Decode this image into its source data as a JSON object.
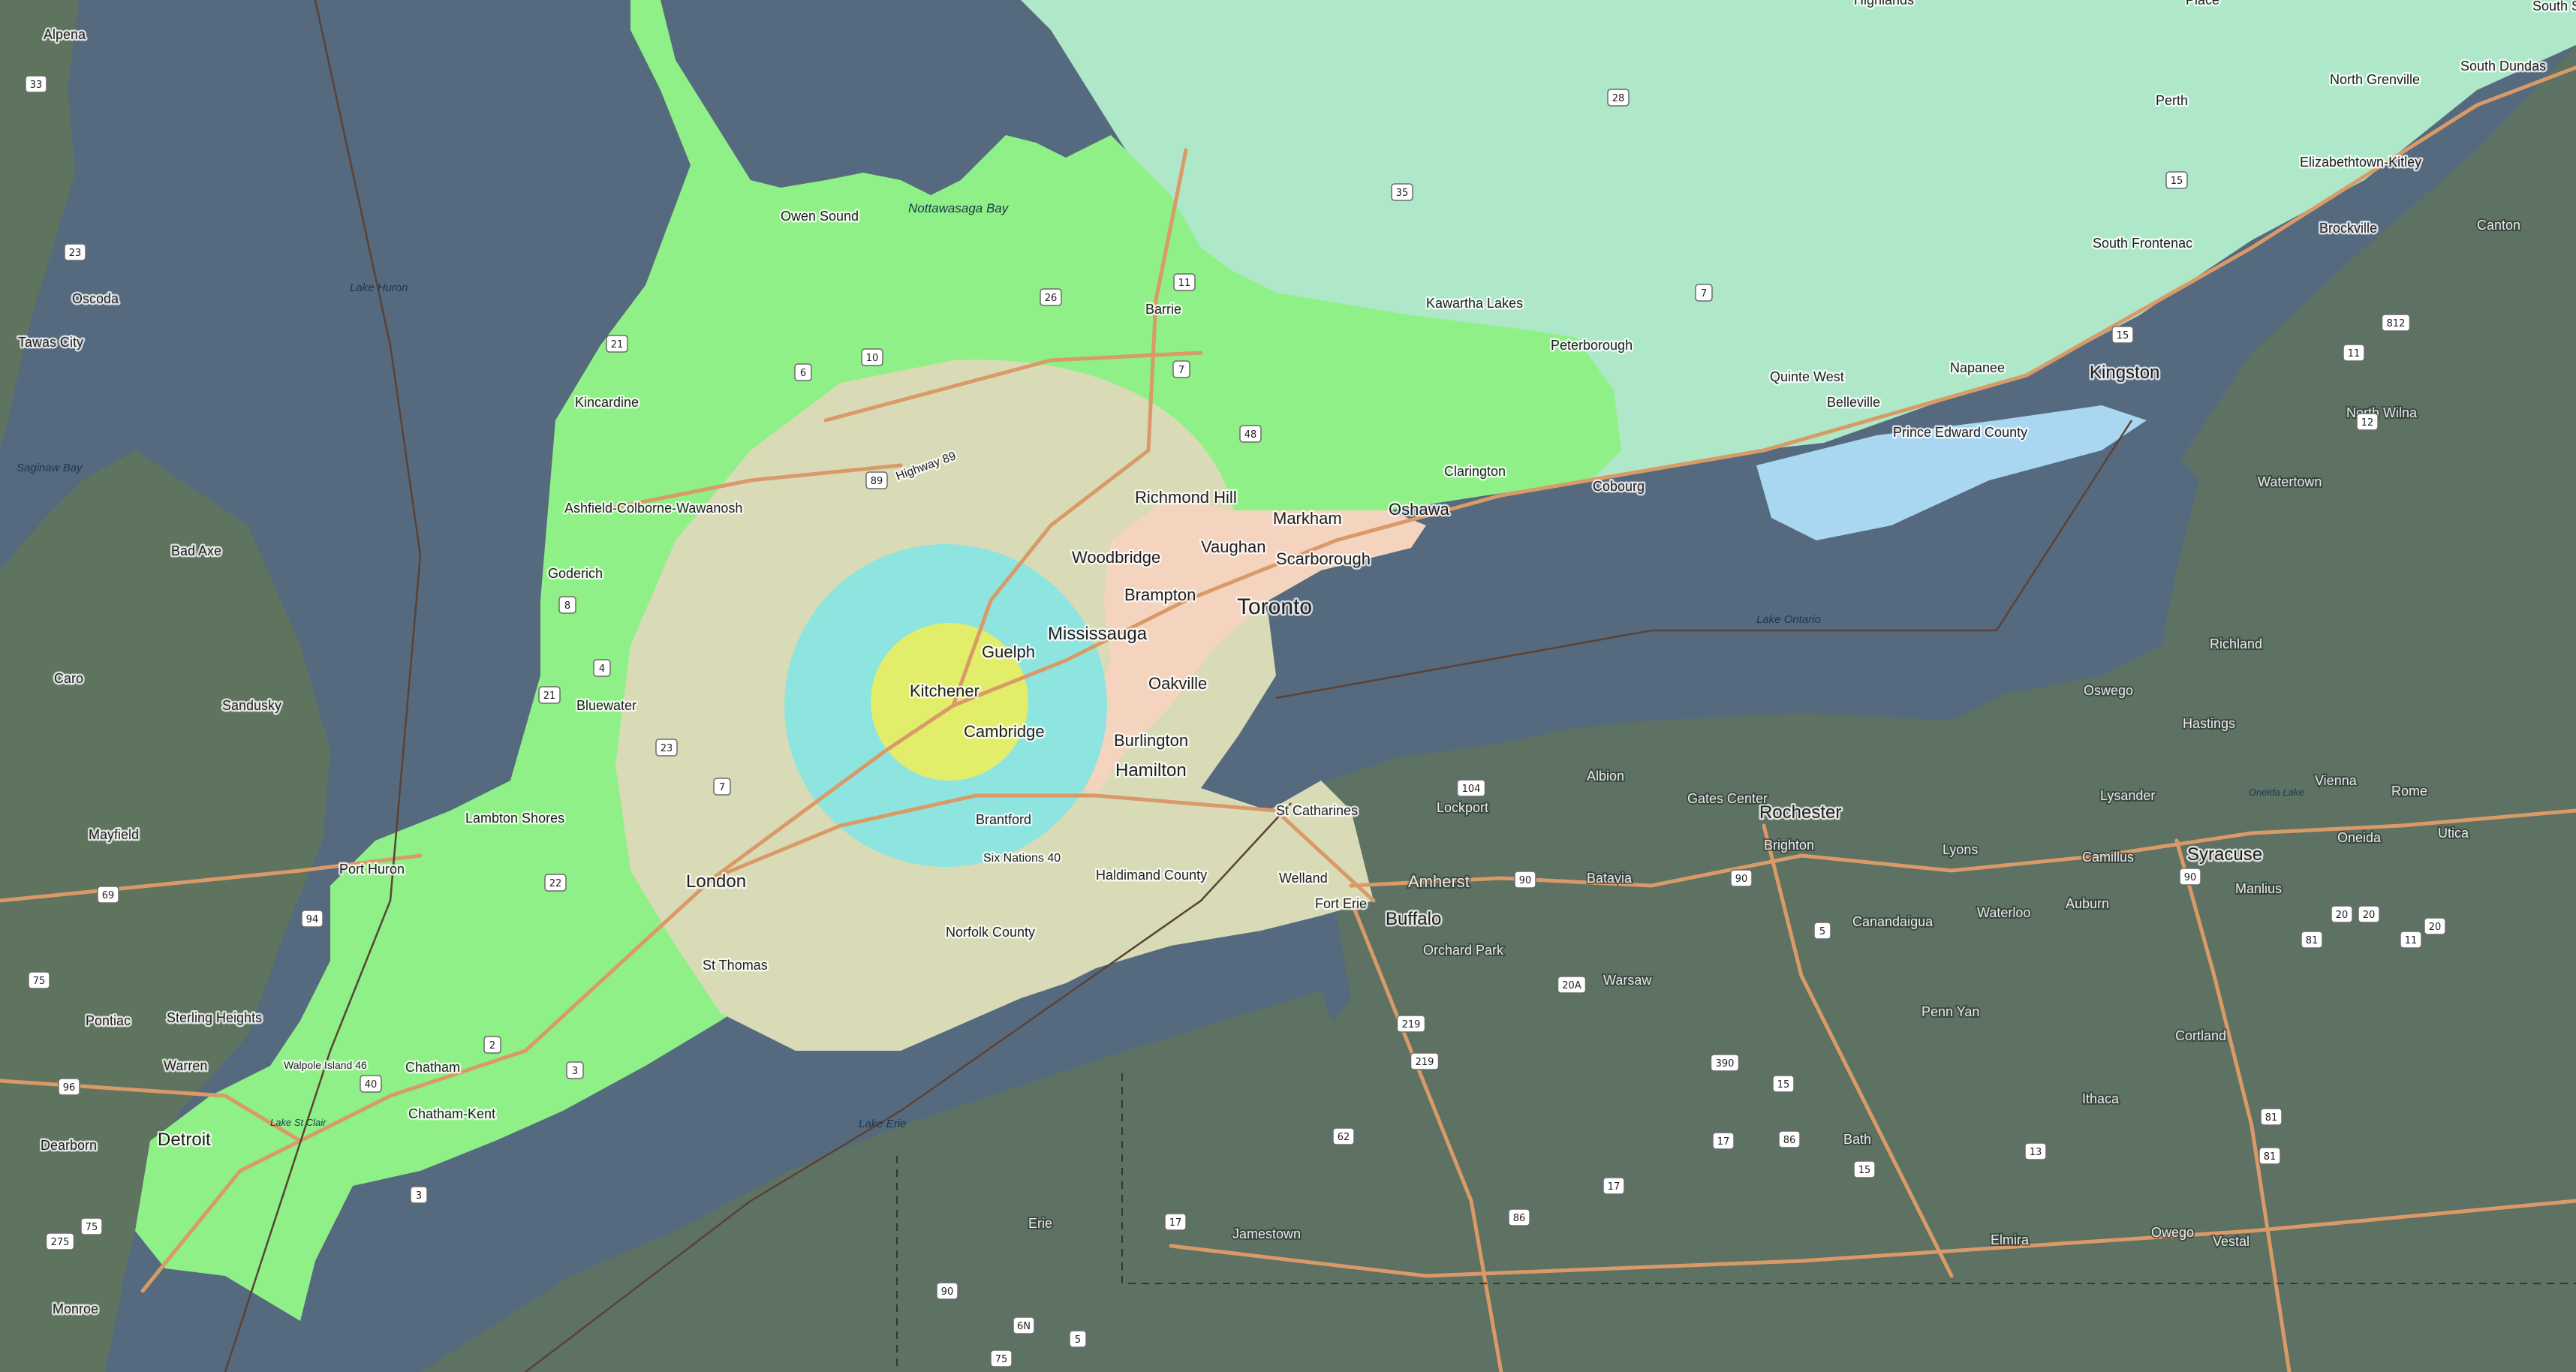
{
  "water_labels": [
    {
      "name": "nottawasaga-bay",
      "text": "Nottawasaga Bay"
    },
    {
      "name": "lake-huron",
      "text": "Lake Huron"
    },
    {
      "name": "saginaw-bay",
      "text": "Saginaw Bay"
    },
    {
      "name": "lake-ontario",
      "text": "Lake Ontario"
    },
    {
      "name": "lake-erie",
      "text": "Lake Erie"
    },
    {
      "name": "lake-st-clair",
      "text": "Lake St Clair"
    },
    {
      "name": "oneida-lake",
      "text": "Oneida Lake"
    }
  ],
  "major_cities": {
    "toronto": "Toronto",
    "kitchener": "Kitchener",
    "cambridge": "Cambridge",
    "guelph": "Guelph",
    "mississauga": "Mississauga",
    "hamilton": "Hamilton",
    "london": "London",
    "buffalo": "Buffalo",
    "rochester": "Rochester",
    "syracuse": "Syracuse",
    "detroit": "Detroit",
    "kingston": "Kingston"
  },
  "towns": {
    "alpena": "Alpena",
    "owen_sound": "Owen Sound",
    "barrie": "Barrie",
    "kincardine": "Kincardine",
    "oscoda": "Oscoda",
    "tawas_city": "Tawas City",
    "ashfield": "Ashfield-Colborne-Wawanosh",
    "goderich": "Goderich",
    "bad_axe": "Bad Axe",
    "caro": "Caro",
    "sandusky": "Sandusky",
    "bluewater": "Bluewater",
    "mayfield": "Mayfield",
    "lambton_shores": "Lambton Shores",
    "port_huron": "Port Huron",
    "sterling_heights": "Sterling Heights",
    "pontiac": "Pontiac",
    "warren": "Warren",
    "dearborn": "Dearborn",
    "chatham": "Chatham",
    "chatham_kent": "Chatham-Kent",
    "walpole": "Walpole Island 46",
    "monroe": "Monroe",
    "st_thomas": "St Thomas",
    "norfolk": "Norfolk County",
    "haldimand": "Haldimand County",
    "brantford": "Brantford",
    "six_nations": "Six Nations 40",
    "burlington": "Burlington",
    "oakville": "Oakville",
    "brampton": "Brampton",
    "woodbridge": "Woodbridge",
    "vaughan": "Vaughan",
    "richmond_hill": "Richmond Hill",
    "markham": "Markham",
    "scarborough": "Scarborough",
    "oshawa": "Oshawa",
    "clarington": "Clarington",
    "cobourg": "Cobourg",
    "peterborough": "Peterborough",
    "kawartha": "Kawartha Lakes",
    "quinte_west": "Quinte West",
    "belleville": "Belleville",
    "napanee": "Napanee",
    "prince_edward": "Prince Edward County",
    "south_frontenac": "South Frontenac",
    "perth": "Perth",
    "north_grenville": "North Grenville",
    "south_dundas": "South Dundas",
    "south_stormont": "South Stormont",
    "elizabethtown": "Elizabethtown-Kitley",
    "brockville": "Brockville",
    "canton": "Canton",
    "watertown": "Watertown",
    "north_wilna": "North Wilna",
    "richland": "Richland",
    "oswego": "Oswego",
    "hastings": "Hastings",
    "lysander": "Lysander",
    "vienna": "Vienna",
    "rome": "Rome",
    "utica": "Utica",
    "oneida": "Oneida",
    "camillus": "Camillus",
    "manlius": "Manlius",
    "lyons": "Lyons",
    "auburn": "Auburn",
    "waterloo": "Waterloo",
    "canandaigua": "Canandaigua",
    "brighton": "Brighton",
    "gates_center": "Gates Center",
    "albion": "Albion",
    "lockport": "Lockport",
    "st_catharines": "St Catharines",
    "welland": "Welland",
    "fort_erie": "Fort Erie",
    "amherst": "Amherst",
    "orchard_park": "Orchard Park",
    "batavia": "Batavia",
    "warsaw": "Warsaw",
    "penn_yan": "Penn Yan",
    "cortland": "Cortland",
    "ithaca": "Ithaca",
    "bath": "Bath",
    "elmira": "Elmira",
    "owego": "Owego",
    "vestal": "Vestal",
    "jamestown": "Jamestown",
    "erie": "Erie",
    "place": "Place",
    "highlands": "Highlands"
  },
  "road_labels": {
    "highway_89": "Highway 89"
  },
  "shields": [
    "33",
    "23",
    "21",
    "6",
    "10",
    "26",
    "11",
    "28",
    "35",
    "7",
    "7",
    "15",
    "15",
    "8",
    "4",
    "23",
    "7",
    "22",
    "2",
    "40",
    "3",
    "3",
    "21",
    "89",
    "48",
    "104",
    "90",
    "90",
    "90",
    "5",
    "20",
    "20",
    "20",
    "62",
    "219",
    "219",
    "390",
    "15",
    "86",
    "17",
    "17",
    "86",
    "15",
    "13",
    "81",
    "81",
    "11",
    "11",
    "81",
    "812",
    "12",
    "20A",
    "17",
    "90",
    "6N",
    "5",
    "75",
    "75",
    "94",
    "69",
    "96",
    "275",
    "75"
  ],
  "colors": {
    "water": "#556a7e",
    "land_us": "#5d7262",
    "land_mi": "#5f745f",
    "land_on_east": "#aee8c8",
    "zone_green": "#8ef086",
    "zone_beige": "#d8dbb6",
    "zone_cyan": "#8ee4de",
    "zone_yellow": "#e2ee6a",
    "urban": "#f4d4bf",
    "road": "#d99a68"
  }
}
